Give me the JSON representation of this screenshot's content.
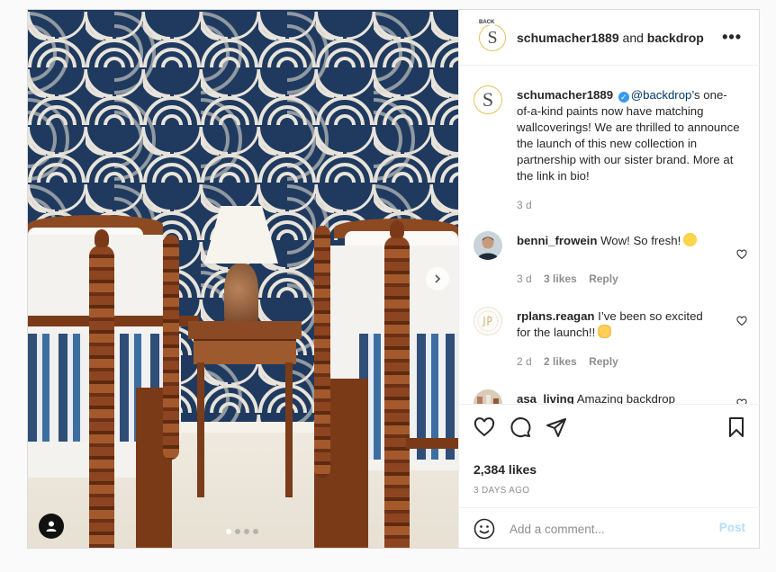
{
  "header": {
    "avatar_badge": "BACK",
    "avatar_letter": "S",
    "account": "schumacher1889",
    "joiner": "and",
    "coauthor": "backdrop",
    "more_icon": "more-horizontal-icon"
  },
  "caption": {
    "avatar_letter": "S",
    "username": "schumacher1889",
    "verified_mark": "✓",
    "mention": "@backdrop",
    "text": "’s one-of-a-kind paints now have matching wallcoverings! We are thrilled to announce the launch of this new collection in partnership with our sister brand. More at the link in bio!",
    "age": "3 d"
  },
  "comments": [
    {
      "username": "benni_frowein",
      "text": "Wow! So fresh!",
      "emoji": "star-struck-emoji",
      "age": "3 d",
      "likes": "3 likes",
      "reply": "Reply"
    },
    {
      "username": "rplans.reagan",
      "text": "I’ve been so excited for the launch!!",
      "emoji": "raising-hands-emoji",
      "age": "2 d",
      "likes": "2 likes",
      "reply": "Reply"
    },
    {
      "username": "asa_living",
      "text": "Amazing backdrop"
    }
  ],
  "stats": {
    "likes": "2,384 likes",
    "date": "3 DAYS AGO"
  },
  "composer": {
    "placeholder": "Add a comment...",
    "post_label": "Post"
  },
  "carousel": {
    "slide_count": 4,
    "current_slide": 1
  },
  "colors": {
    "accent_link": "#00376b",
    "post_disabled": "#b2dffc",
    "wallpaper_navy": "#1f3a5e",
    "avatar_ring": "#e6c25a"
  }
}
